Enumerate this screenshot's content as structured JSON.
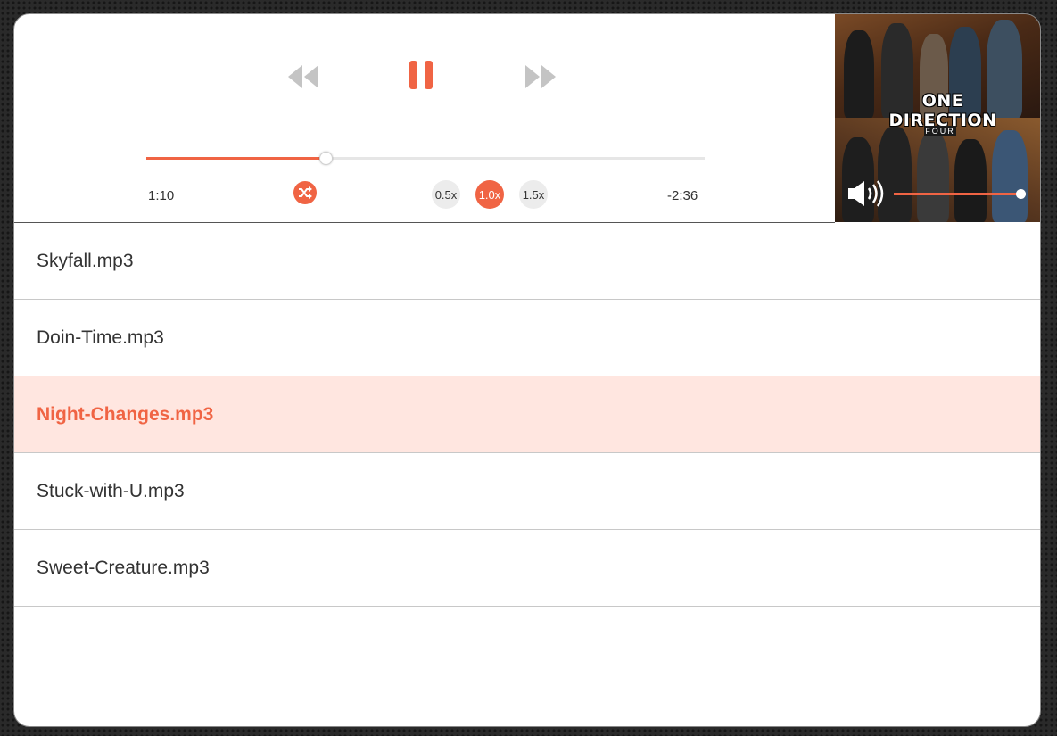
{
  "player": {
    "time_elapsed": "1:10",
    "time_remaining": "-2:36",
    "progress_fraction": 0.32,
    "volume_fraction": 0.96,
    "controls": {
      "rewind_icon": "rewind-icon",
      "pause_icon": "pause-icon",
      "forward_icon": "fast-forward-icon",
      "shuffle_icon": "shuffle-icon",
      "volume_icon": "volume-up-icon"
    },
    "speeds": [
      {
        "label": "0.5x",
        "active": false
      },
      {
        "label": "1.0x",
        "active": true
      },
      {
        "label": "1.5x",
        "active": false
      }
    ],
    "album": {
      "title": "ONE DIRECTION",
      "subtitle": "FOUR"
    }
  },
  "playlist": {
    "tracks": [
      {
        "name": "Skyfall.mp3",
        "active": false
      },
      {
        "name": "Doin-Time.mp3",
        "active": false
      },
      {
        "name": "Night-Changes.mp3",
        "active": true
      },
      {
        "name": "Stuck-with-U.mp3",
        "active": false
      },
      {
        "name": "Sweet-Creature.mp3",
        "active": false
      }
    ]
  },
  "colors": {
    "accent": "#f06444",
    "active_row_bg": "#ffe6e0",
    "control_gray": "#c4c4c4"
  }
}
